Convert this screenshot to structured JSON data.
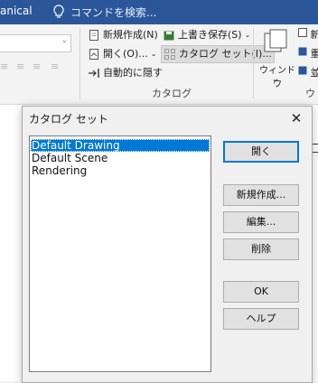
{
  "titlebar": {
    "app_name": "anical",
    "search_placeholder": "コマンドを検索..."
  },
  "ribbon": {
    "new": "新規作成(N)",
    "overwrite_save": "上書き保存(S)",
    "open": "開く(O)...",
    "catalog_set": "カタログ セット(I)...",
    "auto_hide": "自動的に隠す",
    "group_label": "カタログ",
    "window": "ウィンドウ",
    "right_labels": [
      "新",
      "重",
      "並"
    ],
    "right_group_partial": "ウィ"
  },
  "dialog": {
    "title": "カタログ セット",
    "close": "✕",
    "items": [
      "Default Drawing",
      "Default Scene",
      "Rendering"
    ],
    "selected_index": 0,
    "buttons": {
      "open": "開く",
      "new": "新規作成...",
      "edit": "編集...",
      "delete": "削除",
      "ok": "OK",
      "help": "ヘルプ"
    }
  }
}
